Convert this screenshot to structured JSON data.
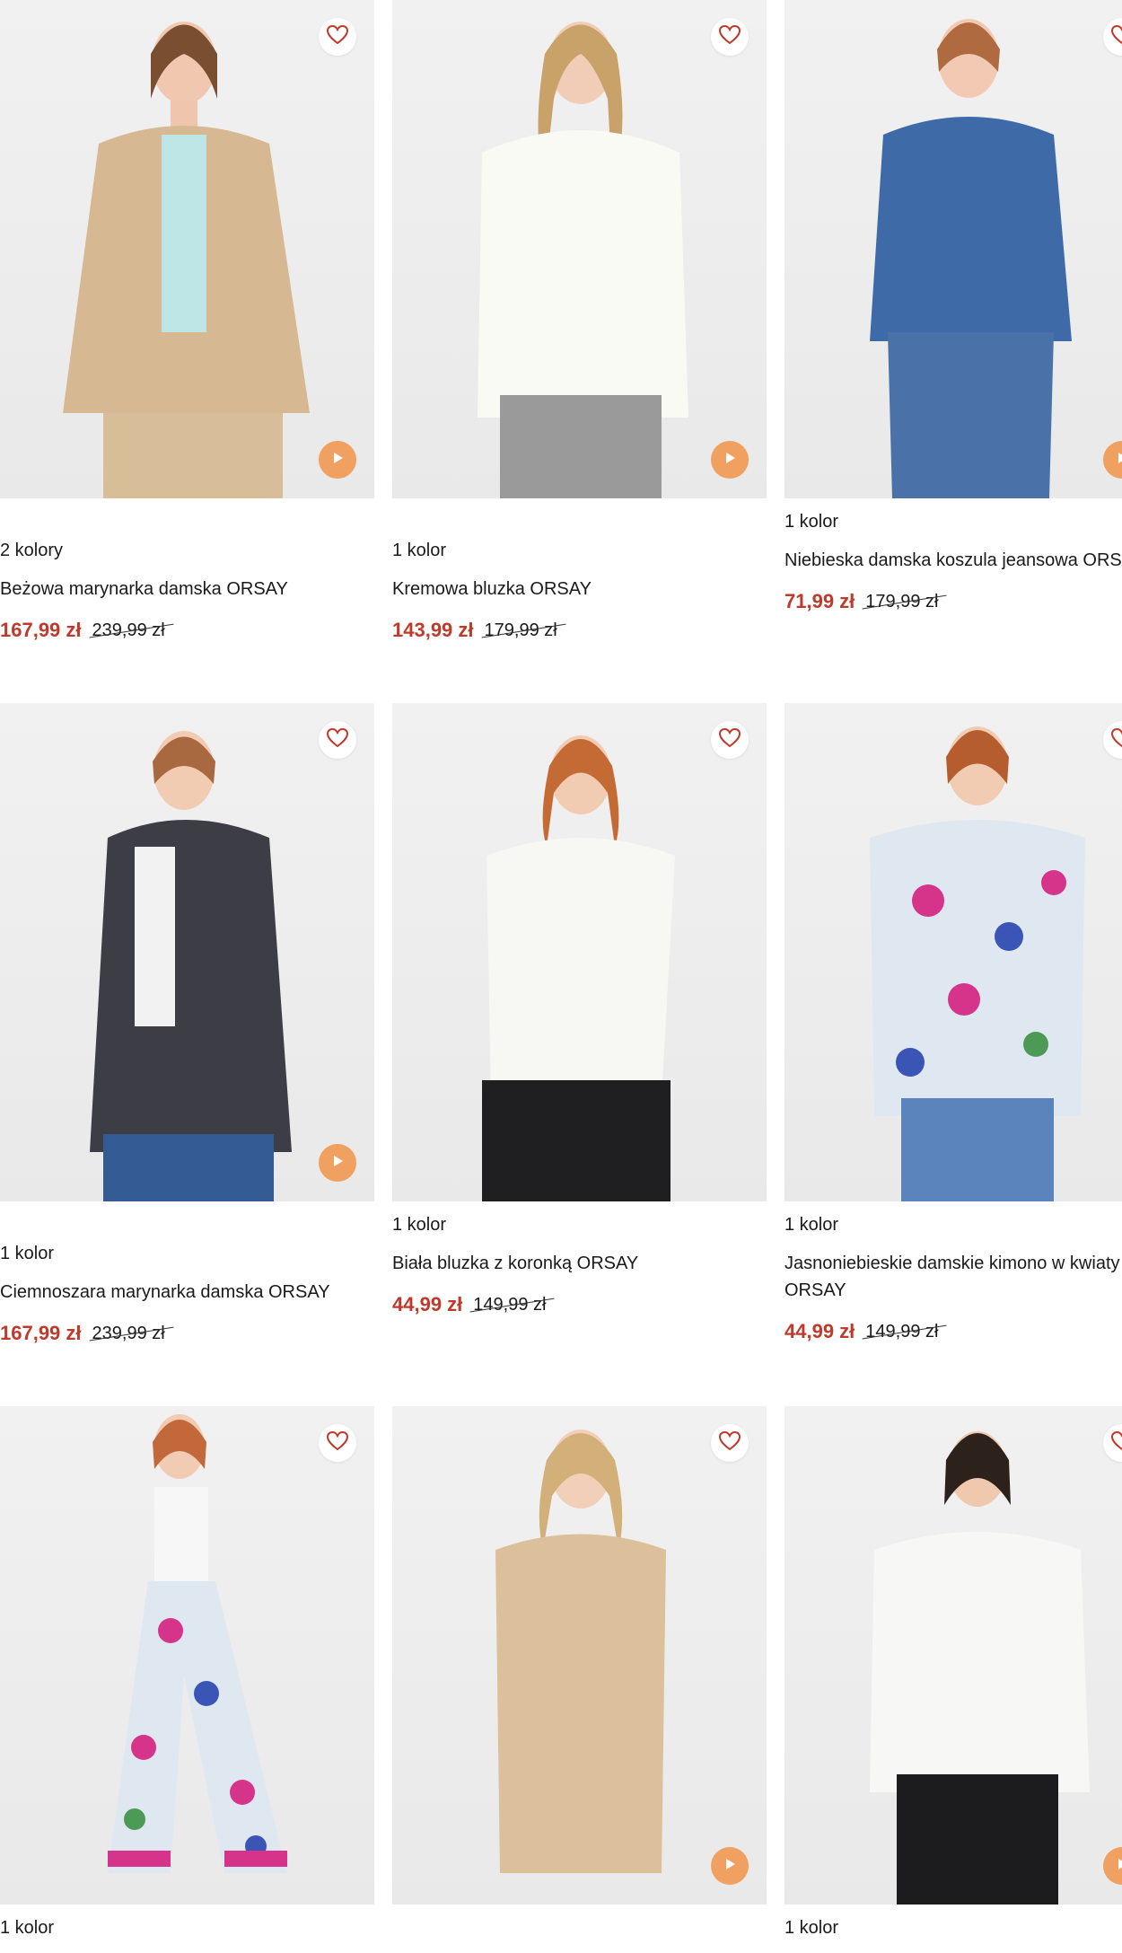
{
  "colors": {
    "sale": "#c0392b",
    "accent": "#f0a060",
    "heart": "#c0392b"
  },
  "icons": {
    "favorite": "heart-icon",
    "video": "play-icon"
  },
  "products": [
    {
      "colors_label": "2 kolory",
      "name": "Beżowa marynarka damska ORSAY",
      "price": "167,99 zł",
      "old_price": "239,99 zł",
      "has_video": true
    },
    {
      "colors_label": "1 kolor",
      "name": "Kremowa bluzka ORSAY",
      "price": "143,99 zł",
      "old_price": "179,99 zł",
      "has_video": true
    },
    {
      "colors_label": "1 kolor",
      "name": "Niebieska damska koszula jeansowa ORSAY",
      "price": "71,99 zł",
      "old_price": "179,99 zł",
      "has_video": true
    },
    {
      "colors_label": "1 kolor",
      "name": "Ciemnoszara marynarka damska ORSAY",
      "price": "167,99 zł",
      "old_price": "239,99 zł",
      "has_video": true
    },
    {
      "colors_label": "1 kolor",
      "name": "Biała bluzka z koronką ORSAY",
      "price": "44,99 zł",
      "old_price": "149,99 zł",
      "has_video": false
    },
    {
      "colors_label": "1 kolor",
      "name": "Jasnoniebieskie damskie kimono w kwiaty ORSAY",
      "price": "44,99 zł",
      "old_price": "149,99 zł",
      "has_video": false
    },
    {
      "colors_label": "1 kolor",
      "name": "",
      "price": "",
      "old_price": "",
      "has_video": false
    },
    {
      "colors_label": "",
      "name": "",
      "price": "",
      "old_price": "",
      "has_video": true
    },
    {
      "colors_label": "1 kolor",
      "name": "",
      "price": "",
      "old_price": "",
      "has_video": true
    }
  ]
}
